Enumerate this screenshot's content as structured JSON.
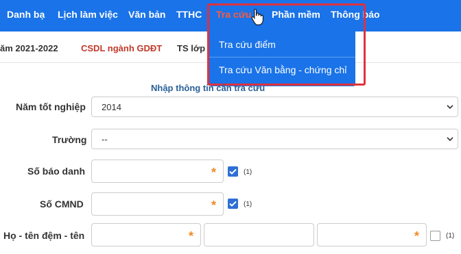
{
  "nav": {
    "items": [
      "Danh bạ",
      "Lịch làm việc",
      "Văn bản",
      "TTHC",
      "Tra cứu",
      "Phần mềm",
      "Thông báo"
    ]
  },
  "subbar": {
    "year": "ăm 2021-2022",
    "csdl": "CSDL ngành GDĐT",
    "ts": "TS lớp"
  },
  "dropdown": {
    "items": [
      "Tra cứu điểm",
      "Tra cứu Văn bằng - chứng chỉ"
    ]
  },
  "form": {
    "section_title": "Nhập thông tin cần tra cứu",
    "year_label": "Năm tốt nghiệp",
    "year_value": "2014",
    "school_label": "Trường",
    "school_value": "--",
    "sbd_label": "Số báo danh",
    "cmnd_label": "Số CMND",
    "name_label": "Họ - tên đệm - tên",
    "required_mark": "*",
    "note": "(1)"
  },
  "colors": {
    "nav_bg": "#1a73e8",
    "active": "#ff5a3c",
    "highlight": "#e0323c",
    "required": "#f08a24",
    "csdl": "#c0392b"
  }
}
